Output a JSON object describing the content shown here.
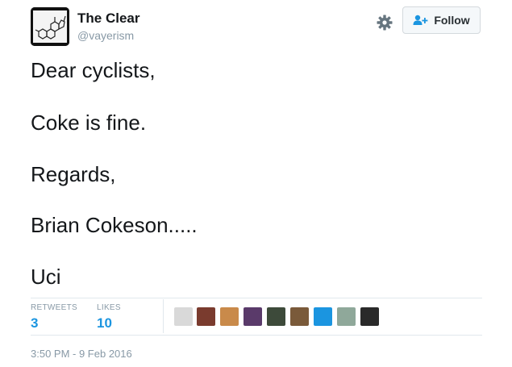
{
  "user": {
    "display_name": "The Clear",
    "handle": "@vayerism",
    "avatar_icon": "molecule-structure-icon"
  },
  "actions": {
    "follow_label": "Follow",
    "settings_icon": "gear-icon",
    "follow_icon": "add-user-icon"
  },
  "tweet": {
    "lines": [
      "Dear cyclists,",
      "Coke is fine.",
      "Regards,",
      "Brian Cokeson.....",
      "Uci"
    ]
  },
  "stats": {
    "retweets_label": "RETWEETS",
    "retweets_count": "3",
    "likes_label": "LIKES",
    "likes_count": "10"
  },
  "likers": [
    {
      "color": "#d9d9d9"
    },
    {
      "color": "#7a3b2e"
    },
    {
      "color": "#c98a4a"
    },
    {
      "color": "#5a3a6a"
    },
    {
      "color": "#3d4a3a"
    },
    {
      "color": "#7a5a3a"
    },
    {
      "color": "#1b95e0"
    },
    {
      "color": "#8fa89a"
    },
    {
      "color": "#2a2a2a"
    }
  ],
  "timestamp": "3:50 PM - 9 Feb 2016",
  "colors": {
    "accent": "#1b95e0",
    "muted": "#8899a6"
  }
}
